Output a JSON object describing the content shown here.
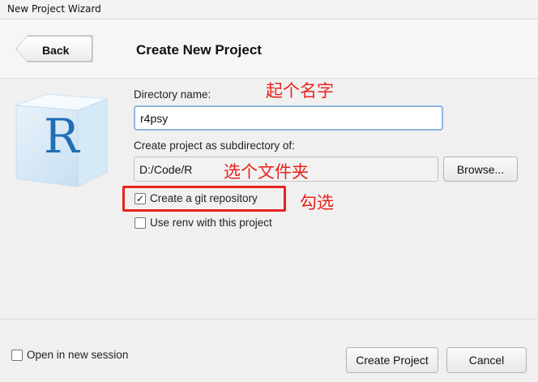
{
  "window": {
    "title": "New Project Wizard"
  },
  "header": {
    "back_label": "Back",
    "page_title": "Create New Project"
  },
  "form": {
    "directory_label": "Directory name:",
    "directory_value": "r4psy",
    "subdir_label": "Create project as subdirectory of:",
    "subdir_value": "D:/Code/R",
    "browse_label": "Browse...",
    "git_checked": true,
    "git_label": "Create a git repository",
    "renv_checked": false,
    "renv_label": "Use renv with this project"
  },
  "annotations": {
    "name_hint": "起个名字",
    "folder_hint": "选个文件夹",
    "check_hint": "勾选",
    "color": "#e8231c"
  },
  "footer": {
    "new_session_checked": false,
    "new_session_label": "Open in new session",
    "create_label": "Create Project",
    "cancel_label": "Cancel"
  },
  "logo": {
    "letter": "R",
    "accent": "#1f6fb5"
  }
}
